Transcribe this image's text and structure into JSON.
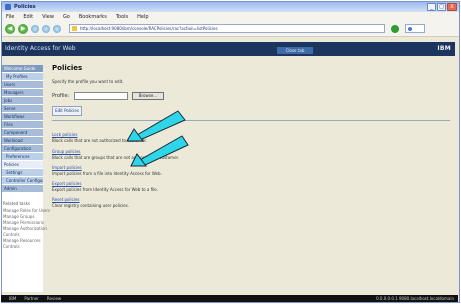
{
  "window": {
    "title": "Policies",
    "controls": {
      "minimize": "_",
      "maximize": "□",
      "close": "X"
    }
  },
  "menu": [
    "File",
    "Edit",
    "View",
    "Go",
    "Bookmarks",
    "Tools",
    "Help"
  ],
  "toolbar": {
    "back_label": "◀",
    "forward_label": "▶",
    "address": "http://localhost:9080/ibm/console/RACPolicies/rac?action=listPolicies"
  },
  "banner": {
    "app_name": "Identity Access for Web",
    "button_label": "Close tab",
    "brand": "IBM"
  },
  "sidebar": {
    "items": [
      {
        "label": "Welcome Guide",
        "style": "header"
      },
      {
        "label": "My Profiles",
        "style": "sub"
      },
      {
        "label": "Users",
        "style": ""
      },
      {
        "label": "Managers",
        "style": ""
      },
      {
        "label": "Jobs",
        "style": ""
      },
      {
        "label": "Serve",
        "style": ""
      },
      {
        "label": "Workflows",
        "style": ""
      },
      {
        "label": "Files",
        "style": ""
      },
      {
        "label": "Component",
        "style": ""
      },
      {
        "label": "Workload",
        "style": ""
      },
      {
        "label": "Configuration",
        "style": ""
      },
      {
        "label": "Preferences",
        "style": "sub"
      },
      {
        "label": "Policies",
        "style": "selected"
      },
      {
        "label": "Settings",
        "style": "sub"
      },
      {
        "label": "Controller Configuration",
        "style": "sub"
      },
      {
        "label": "Admin",
        "style": ""
      }
    ],
    "related_heading": "Related tasks",
    "related": [
      "Manage Roles for Users",
      "Manage Groups",
      "Manage Permissions",
      "Manage Authorization",
      "Controls",
      "Manage Resources",
      "Controls"
    ]
  },
  "main": {
    "title": "Policies",
    "intro": "Specify the profile you want to edit.",
    "profile_label": "Profile:",
    "profile_value": "",
    "browse_label": "Browse...",
    "edit_label": "Edit Policies",
    "links": [
      {
        "label": "Lock policies",
        "desc": "Block calls that are not authorized to customer."
      },
      {
        "label": "Group policies",
        "desc": "Block calls that are groups that are not authorized to customer."
      },
      {
        "label": "Import policies",
        "desc": "Import policies from a file into Identity Access for Web."
      },
      {
        "label": "Export policies",
        "desc": "Export policies from Identity Access for Web to a file."
      },
      {
        "label": "Reset policies",
        "desc": "Clear registry containing user policies."
      }
    ]
  },
  "status": {
    "left": [
      "IBM",
      "Partner",
      "Review"
    ],
    "right": "0.0.0.0.0.1 9080.localhost.localdomain"
  },
  "colors": {
    "arrow_fill": "#2fd6e8",
    "arrow_stroke": "#1a2a3a",
    "banner": "#1b355f"
  }
}
